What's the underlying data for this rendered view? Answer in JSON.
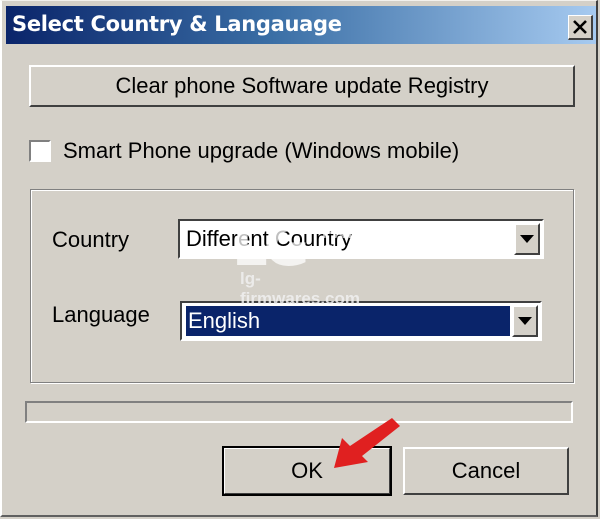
{
  "window": {
    "title": "Select Country & Langauage",
    "close_glyph": "✕"
  },
  "clear_registry_button": {
    "label": "Clear phone Software update Registry"
  },
  "smartphone_upgrade": {
    "label": "Smart Phone upgrade (Windows mobile)",
    "checked": false
  },
  "country": {
    "label": "Country",
    "selected": "Different Country"
  },
  "language": {
    "label": "Language",
    "selected": "English"
  },
  "progress": {
    "value_percent": 0
  },
  "buttons": {
    "ok": "OK",
    "cancel": "Cancel"
  },
  "watermark": {
    "logo": "LG",
    "line1": "FAN",
    "line2": "CLUB",
    "url": "lg-firmwares.com"
  },
  "colors": {
    "title_gradient_start": "#0a246a",
    "title_gradient_end": "#a6caf0",
    "selection": "#0a246a",
    "face": "#d4d0c8",
    "annotation_arrow": "#e02020"
  }
}
